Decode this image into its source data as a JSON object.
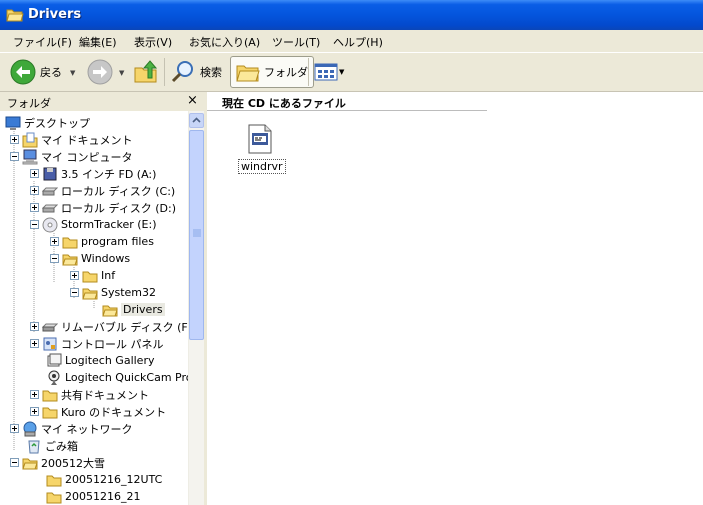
{
  "window": {
    "title": "Drivers"
  },
  "menu": [
    {
      "label": "ファイル(F)"
    },
    {
      "label": "編集(E)"
    },
    {
      "label": "表示(V)"
    },
    {
      "label": "お気に入り(A)"
    },
    {
      "label": "ツール(T)"
    },
    {
      "label": "ヘルプ(H)"
    }
  ],
  "toolbar": {
    "back_label": "戻る",
    "search_label": "検索",
    "folders_label": "フォルダ"
  },
  "folder_pane": {
    "title": "フォルダ",
    "close_glyph": "×"
  },
  "tree": [
    {
      "label": "デスクトップ",
      "icon": "desktop-icon"
    },
    {
      "label": "マイ ドキュメント",
      "icon": "my-documents-icon"
    },
    {
      "label": "マイ コンピュータ",
      "icon": "my-computer-icon"
    },
    {
      "label": "3.5 インチ FD (A:)",
      "icon": "floppy-icon"
    },
    {
      "label": "ローカル ディスク (C:)",
      "icon": "hard-disk-icon"
    },
    {
      "label": "ローカル ディスク (D:)",
      "icon": "hard-disk-icon"
    },
    {
      "label": "StormTracker (E:)",
      "icon": "cd-drive-icon"
    },
    {
      "label": "program files",
      "icon": "folder-icon"
    },
    {
      "label": "Windows",
      "icon": "folder-open-icon"
    },
    {
      "label": "Inf",
      "icon": "folder-icon"
    },
    {
      "label": "System32",
      "icon": "folder-open-icon"
    },
    {
      "label": "Drivers",
      "icon": "folder-open-icon"
    },
    {
      "label": "リムーバブル ディスク (F:)",
      "icon": "removable-disk-icon"
    },
    {
      "label": "コントロール パネル",
      "icon": "control-panel-icon"
    },
    {
      "label": "Logitech Gallery",
      "icon": "logitech-gallery-icon"
    },
    {
      "label": "Logitech QuickCam Pro",
      "icon": "webcam-icon"
    },
    {
      "label": "共有ドキュメント",
      "icon": "folder-icon"
    },
    {
      "label": "Kuro のドキュメント",
      "icon": "folder-icon"
    },
    {
      "label": "マイ ネットワーク",
      "icon": "network-icon"
    },
    {
      "label": "ごみ箱",
      "icon": "recycle-bin-icon"
    },
    {
      "label": "200512大雪",
      "icon": "folder-open-icon"
    },
    {
      "label": "20051216_12UTC",
      "icon": "folder-icon"
    },
    {
      "label": "20051216_21",
      "icon": "folder-icon"
    }
  ],
  "content": {
    "header": "現在 CD にあるファイル",
    "files": [
      {
        "label": "windrvr",
        "icon": "setup-info-file-icon"
      }
    ]
  }
}
